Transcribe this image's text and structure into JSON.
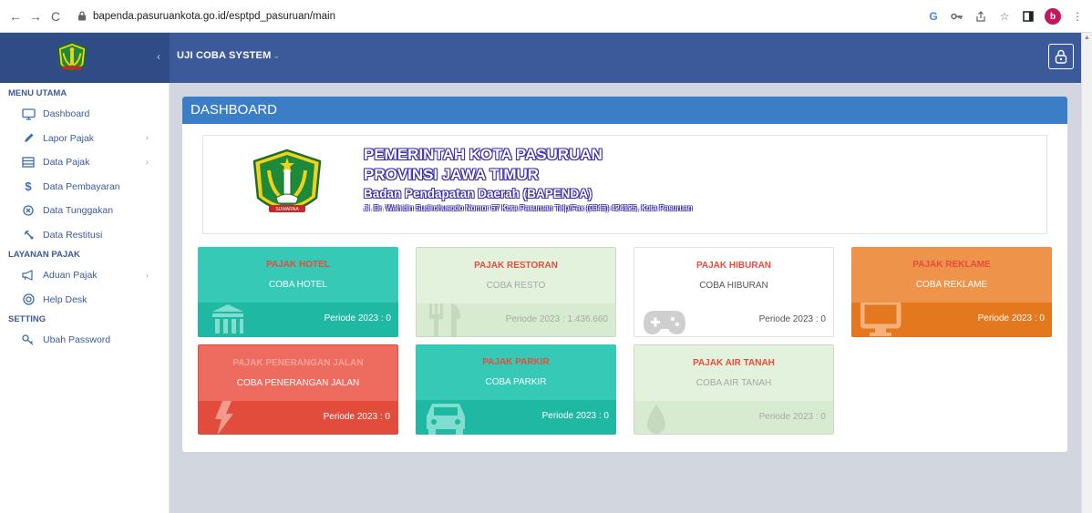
{
  "browser": {
    "back": "←",
    "forward": "→",
    "reload": "C",
    "url": "bapenda.pasuruankota.go.id/esptpd_pasuruan/main",
    "profile_initial": "b"
  },
  "header": {
    "app_name": "UJI COBA SYSTEM",
    "collapse": "‹",
    "caret": "⌄"
  },
  "sidebar": {
    "sections": [
      {
        "title": "MENU UTAMA"
      },
      {
        "title": "LAYANAN PAJAK"
      },
      {
        "title": "SETTING"
      }
    ],
    "items": [
      {
        "label": "Dashboard",
        "icon": "monitor-icon"
      },
      {
        "label": "Lapor Pajak",
        "icon": "pencil-icon",
        "has_submenu": true
      },
      {
        "label": "Data Pajak",
        "icon": "list-icon",
        "has_submenu": true
      },
      {
        "label": "Data Pembayaran",
        "icon": "dollar-icon"
      },
      {
        "label": "Data Tunggakan",
        "icon": "circle-x-icon"
      },
      {
        "label": "Data Restitusi",
        "icon": "refresh-icon"
      },
      {
        "label": "Aduan Pajak",
        "icon": "megaphone-icon",
        "has_submenu": true
      },
      {
        "label": "Help Desk",
        "icon": "lifebuoy-icon"
      },
      {
        "label": "Ubah Password",
        "icon": "key-icon"
      }
    ],
    "arrow": "›"
  },
  "dashboard": {
    "title": "DASHBOARD",
    "banner": {
      "line1": "PEMERINTAH KOTA PASURUAN",
      "line2": "PROVINSI JAWA TIMUR",
      "line3": "Badan Pendapatan Daerah (BAPENDA)",
      "line4": "Jl. Dr. Wahidin Sudirohusodo Nomor 67 Kota Pasuruan Telp/Fax (0343) 424125, Kota Pasuruan"
    },
    "tiles": [
      {
        "title": "PAJAK HOTEL",
        "sub": "COBA HOTEL",
        "period": "Periode 2023 : 0",
        "icon": "bank-icon"
      },
      {
        "title": "PAJAK RESTORAN",
        "sub": "COBA RESTO",
        "period": "Periode 2023 : 1.436.660",
        "icon": "cutlery-icon"
      },
      {
        "title": "PAJAK HIBURAN",
        "sub": "COBA HIBURAN",
        "period": "Periode 2023 : 0",
        "icon": "gamepad-icon"
      },
      {
        "title": "PAJAK REKLAME",
        "sub": "COBA REKLAME",
        "period": "Periode 2023 : 0",
        "icon": "monitor-icon"
      },
      {
        "title": "PAJAK PENERANGAN JALAN",
        "sub": "COBA PENERANGAN JALAN",
        "period": "Periode 2023 : 0",
        "icon": "bolt-icon"
      },
      {
        "title": "PAJAK PARKIR",
        "sub": "COBA PARKIR",
        "period": "Periode 2023 : 0",
        "icon": "car-icon"
      },
      {
        "title": "PAJAK AIR TANAH",
        "sub": "COBA AIR TANAH",
        "period": "Periode 2023 : 0",
        "icon": "drop-icon"
      }
    ]
  }
}
